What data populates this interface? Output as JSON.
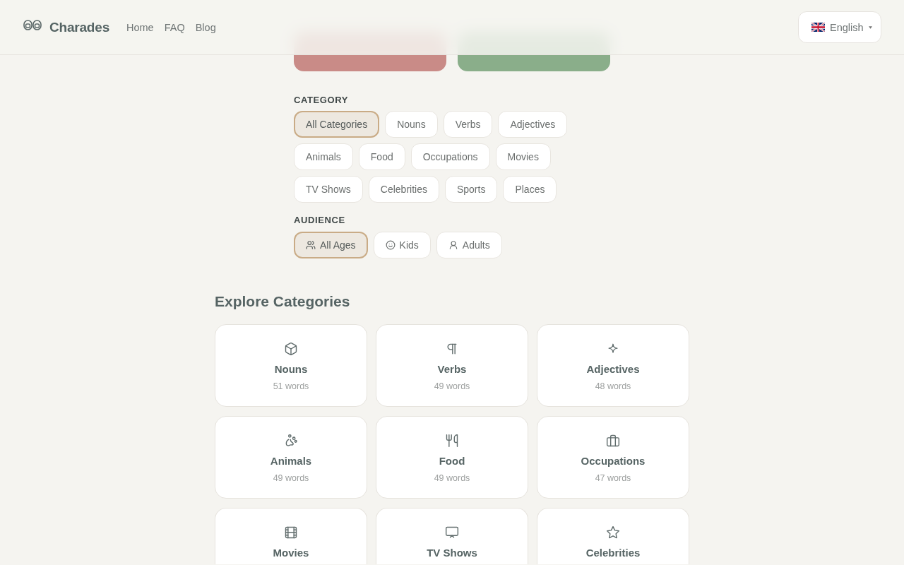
{
  "header": {
    "brand": "Charades",
    "nav": [
      {
        "label": "Home"
      },
      {
        "label": "FAQ"
      },
      {
        "label": "Blog"
      }
    ],
    "language": {
      "label": "English"
    }
  },
  "actions": [
    {
      "kind": "dismiss"
    },
    {
      "kind": "confirm"
    }
  ],
  "filters": {
    "category": {
      "label": "CATEGORY",
      "options": [
        {
          "label": "All Categories",
          "selected": true
        },
        {
          "label": "Nouns",
          "selected": false
        },
        {
          "label": "Verbs",
          "selected": false
        },
        {
          "label": "Adjectives",
          "selected": false
        },
        {
          "label": "Animals",
          "selected": false
        },
        {
          "label": "Food",
          "selected": false
        },
        {
          "label": "Occupations",
          "selected": false
        },
        {
          "label": "Movies",
          "selected": false
        },
        {
          "label": "TV Shows",
          "selected": false
        },
        {
          "label": "Celebrities",
          "selected": false
        },
        {
          "label": "Sports",
          "selected": false
        },
        {
          "label": "Places",
          "selected": false
        }
      ]
    },
    "audience": {
      "label": "AUDIENCE",
      "options": [
        {
          "label": "All Ages",
          "selected": true
        },
        {
          "label": "Kids",
          "selected": false
        },
        {
          "label": "Adults",
          "selected": false
        }
      ]
    }
  },
  "explore": {
    "title": "Explore Categories",
    "cards": [
      {
        "title": "Nouns",
        "count": "51 words"
      },
      {
        "title": "Verbs",
        "count": "49 words"
      },
      {
        "title": "Adjectives",
        "count": "48 words"
      },
      {
        "title": "Animals",
        "count": "49 words"
      },
      {
        "title": "Food",
        "count": "49 words"
      },
      {
        "title": "Occupations",
        "count": "47 words"
      },
      {
        "title": "Movies"
      },
      {
        "title": "TV Shows"
      },
      {
        "title": "Celebrities"
      }
    ]
  }
}
